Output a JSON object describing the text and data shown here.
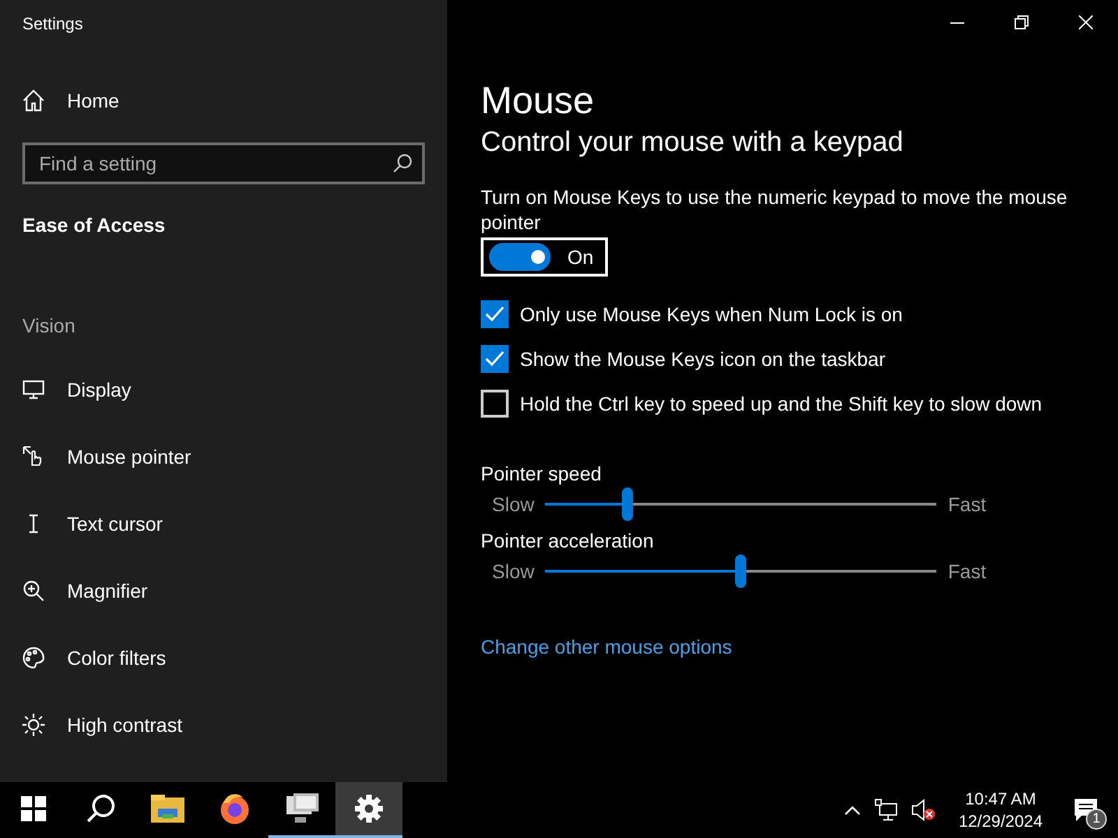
{
  "window": {
    "title": "Settings"
  },
  "sidebar": {
    "home": {
      "label": "Home",
      "selected": false
    },
    "search": {
      "placeholder": "Find a setting"
    },
    "section": "Ease of Access",
    "group": "Vision",
    "items": [
      {
        "label": "Display",
        "selected": false
      },
      {
        "label": "Mouse pointer",
        "selected": false
      },
      {
        "label": "Text cursor",
        "selected": false
      },
      {
        "label": "Magnifier",
        "selected": false
      },
      {
        "label": "Color filters",
        "selected": false
      },
      {
        "label": "High contrast",
        "selected": false
      }
    ]
  },
  "content": {
    "title": "Mouse",
    "subtitle": "Control your mouse with a keypad",
    "description": "Turn on Mouse Keys to use the numeric keypad to move the mouse pointer",
    "toggle": {
      "on": true,
      "label": "On",
      "focused": true
    },
    "checkboxes": [
      {
        "label": "Only use Mouse Keys when Num Lock is on",
        "checked": true
      },
      {
        "label": "Show the Mouse Keys icon on the taskbar",
        "checked": true
      },
      {
        "label": "Hold the Ctrl key to speed up and the Shift key to slow down",
        "checked": false
      }
    ],
    "sliders": [
      {
        "label": "Pointer speed",
        "min_label": "Slow",
        "max_label": "Fast",
        "level": 0.21
      },
      {
        "label": "Pointer acceleration",
        "min_label": "Slow",
        "max_label": "Fast",
        "level": 0.5
      }
    ],
    "link": "Change other mouse options"
  },
  "taskbar": {
    "apps": [
      {
        "running": false,
        "selected": false
      },
      {
        "running": false,
        "selected": false
      },
      {
        "running": false,
        "selected": false
      },
      {
        "running": false,
        "selected": false
      },
      {
        "running": true,
        "selected": false
      },
      {
        "running": true,
        "selected": true
      }
    ],
    "time": "10:47 AM",
    "date": "12/29/2024",
    "notification_count": "1"
  }
}
